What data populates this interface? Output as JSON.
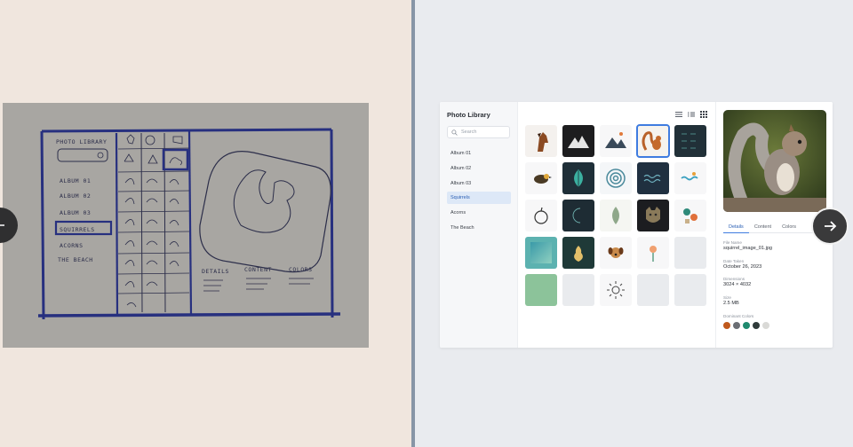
{
  "sketch": {
    "title": "PHOTO LIBRARY",
    "albums": [
      "ALBUM 01",
      "ALBUM 02",
      "ALBUM 03",
      "SQUIRRELS",
      "ACORNS",
      "THE BEACH"
    ],
    "tabs": [
      "DETAILS",
      "CONTENT",
      "COLORS"
    ]
  },
  "navigation": {
    "prev_icon": "arrow-left-icon",
    "next_icon": "arrow-right-icon"
  },
  "app": {
    "title": "Photo Library",
    "search": {
      "placeholder": "Search"
    },
    "albums": [
      {
        "label": "Album 01",
        "active": false
      },
      {
        "label": "Album 02",
        "active": false
      },
      {
        "label": "Album 03",
        "active": false
      },
      {
        "label": "Squirrels",
        "active": true
      },
      {
        "label": "Acorns",
        "active": false
      },
      {
        "label": "The Beach",
        "active": false
      }
    ],
    "view_icons": [
      "list-view-icon",
      "compact-list-icon",
      "grid-view-icon"
    ],
    "thumbnails": [
      "horse-head",
      "mountain-dark",
      "mountains-light",
      "squirrel",
      "leaf-pattern",
      "bird",
      "leaf-teal",
      "spiral",
      "waves-dark",
      "waves-light",
      "apple",
      "moon",
      "leaf-sage",
      "cat",
      "geometric-shapes",
      "teal-gradient",
      "pear",
      "dog",
      "flower",
      "empty",
      "green-gradient",
      "empty",
      "sun",
      "empty",
      "empty"
    ],
    "selected_thumbnail": "squirrel",
    "details": {
      "tabs": [
        {
          "label": "Details",
          "active": true
        },
        {
          "label": "Content",
          "active": false
        },
        {
          "label": "Colors",
          "active": false
        }
      ],
      "properties": [
        {
          "label": "File Name",
          "value": "squirrel_image_01.jpg"
        },
        {
          "label": "Date Taken",
          "value": "October 26, 2023"
        },
        {
          "label": "Dimensions",
          "value": "3024 × 4032"
        },
        {
          "label": "Size",
          "value": "2.5 MB"
        }
      ],
      "colors_label": "Dominant Colors",
      "dominant_colors": [
        "#c0591d",
        "#6b6e74",
        "#1f8a6e",
        "#2f3b3a",
        "#d9d9d6"
      ]
    }
  },
  "colors": {
    "accent": "#3f7ce0",
    "active_album_bg": "#dde8f7",
    "sketch_ink": "#27307f"
  }
}
